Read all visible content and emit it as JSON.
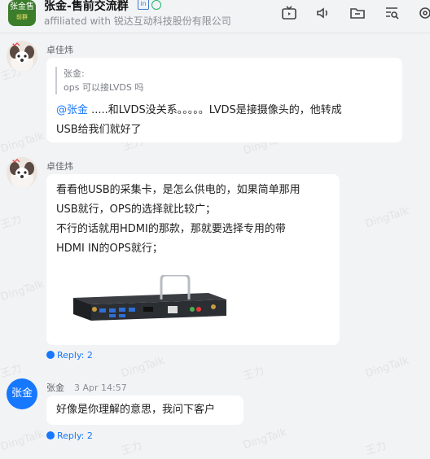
{
  "header": {
    "group_avatar_line1": "张金售",
    "group_avatar_line2": "前群",
    "title": "张金-售前交流群",
    "badge_in": "in",
    "subtitle": "affiliated with 锐达互动科技股份有限公司",
    "toolbar": [
      "live-icon",
      "audio-icon",
      "folder-icon",
      "search-list-icon",
      "settings-icon"
    ]
  },
  "watermarks": [
    "DingTalk",
    "王力"
  ],
  "messages": [
    {
      "sender": "卓佳炜",
      "quote_author": "张金:",
      "quote_text": "ops 可以接LVDS 吗",
      "mention": "@张金",
      "text_line1": " .....和LVDS没关系。。。。。LVDS是接摄像头的，他转成",
      "text_line2": "USB给我们就好了"
    },
    {
      "sender": "卓佳炜",
      "lines": [
        "看看他USB的采集卡，是怎么供电的，如果简单那用",
        "USB就行，OPS的选择就比较广；",
        "不行的话就用HDMI的那款，那就要选择专用的带",
        "HDMI IN的OPS就行；"
      ],
      "reply": "Reply: 2"
    },
    {
      "sender": "张金",
      "avatar_text": "张金",
      "time": "3 Apr 14:57",
      "text": "好像是你理解的意思，我问下客户",
      "reply": "Reply: 2"
    }
  ]
}
